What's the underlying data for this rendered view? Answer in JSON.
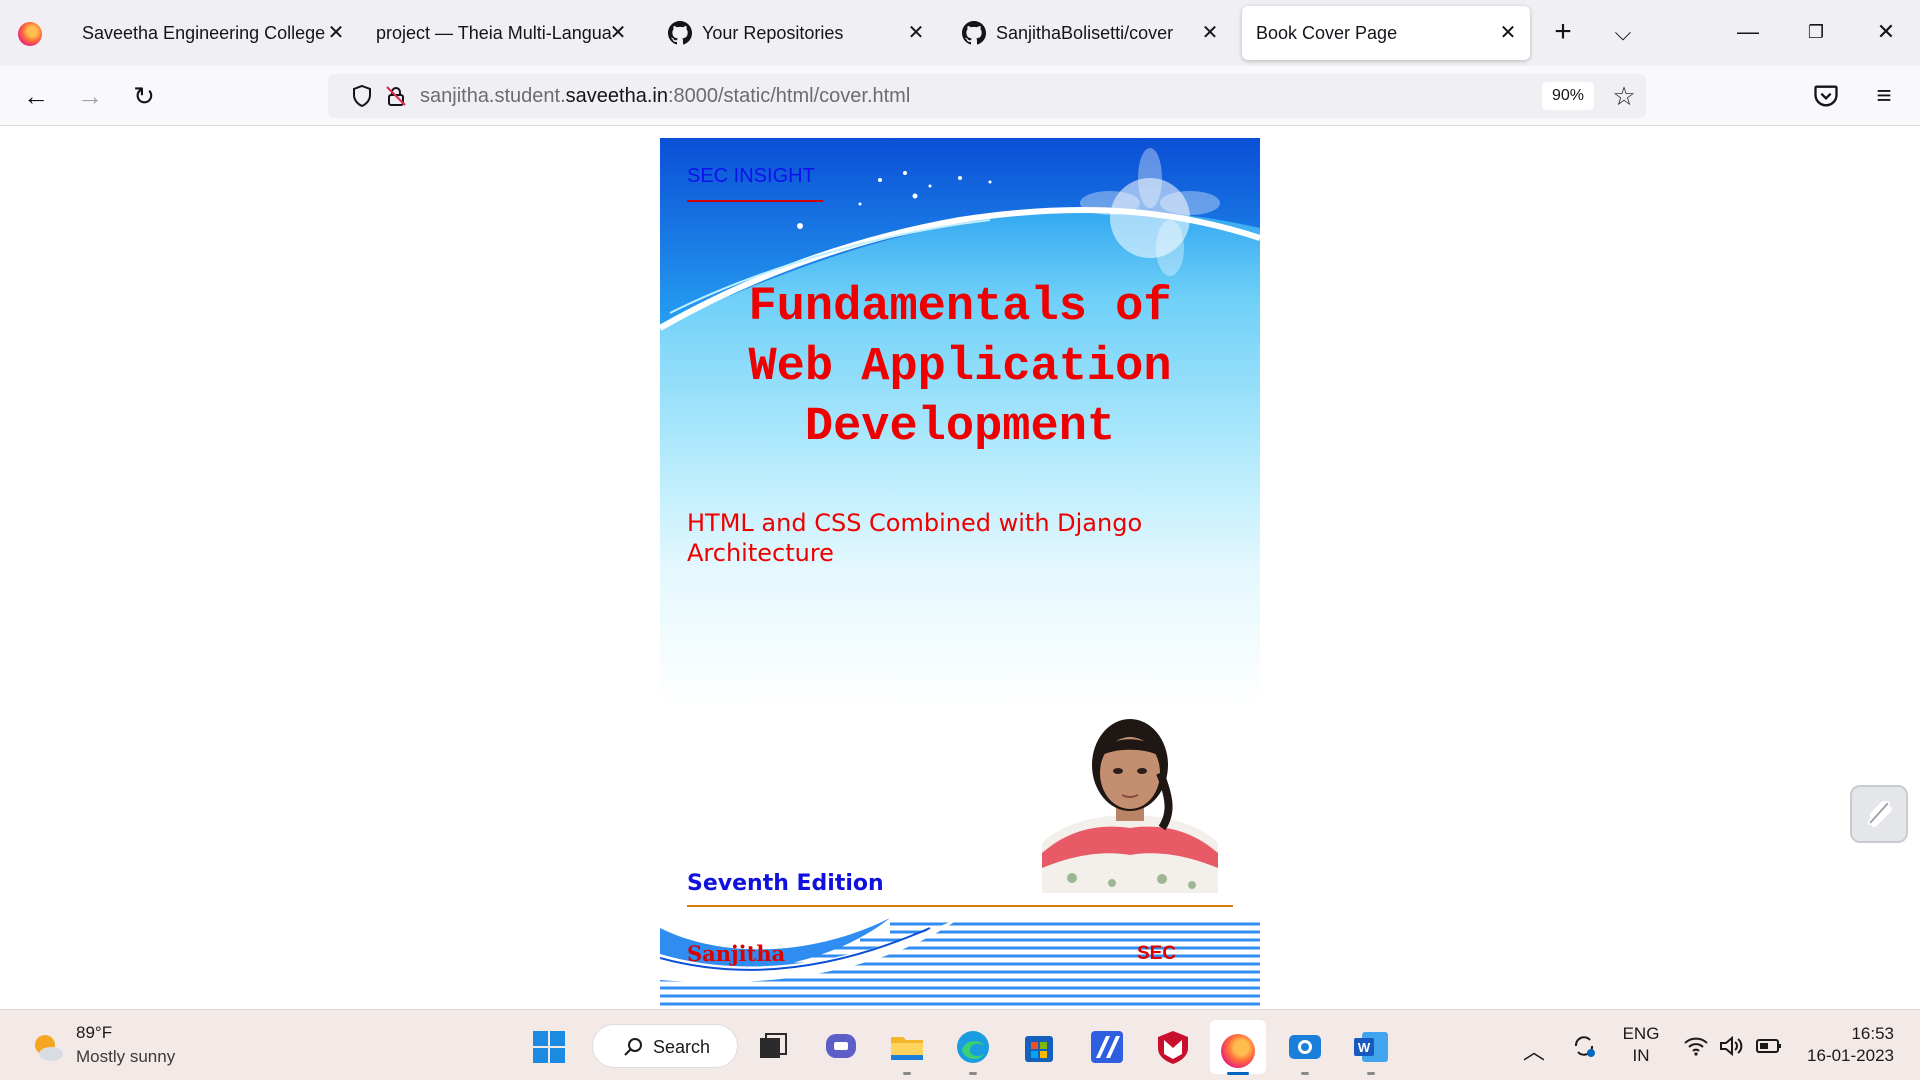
{
  "browser": {
    "tabs": [
      {
        "label": "Saveetha Engineering College",
        "icon": "firefox-icon",
        "active": false
      },
      {
        "label": "project — Theia Multi-Langua",
        "icon": "none",
        "active": false
      },
      {
        "label": "Your Repositories",
        "icon": "github-icon",
        "active": false
      },
      {
        "label": "SanjithaBolisetti/cover",
        "icon": "github-icon",
        "active": false
      },
      {
        "label": "Book Cover Page",
        "icon": "none",
        "active": true
      }
    ],
    "url": {
      "prefix": "sanjitha.student.",
      "host": "saveetha.in",
      "suffix": ":8000/static/html/cover.html"
    },
    "zoom": "90%"
  },
  "cover": {
    "series_label": "SEC INSIGHT",
    "title_lines": [
      "Fundamentals of",
      "Web Application",
      "Development"
    ],
    "subtitle_lines": [
      "HTML and CSS Combined with Django",
      "Architecture"
    ],
    "edition": "Seventh Edition",
    "author": "Sanjitha",
    "publisher": "SEC",
    "colors": {
      "title": "#ee0000",
      "series_label": "#1111ee",
      "edition": "#1111dd"
    }
  },
  "taskbar": {
    "weather": {
      "temp": "89°F",
      "condition": "Mostly sunny",
      "icon": "partly-sunny-icon"
    },
    "search_label": "Search",
    "apps": [
      "file-explorer-icon",
      "teams-chat-icon",
      "folder-icon",
      "edge-icon",
      "store-icon",
      "app-icon",
      "mcafee-icon",
      "firefox-icon",
      "camera-icon",
      "word-icon"
    ],
    "language": [
      "ENG",
      "IN"
    ],
    "time": "16:53",
    "date": "16-01-2023"
  }
}
